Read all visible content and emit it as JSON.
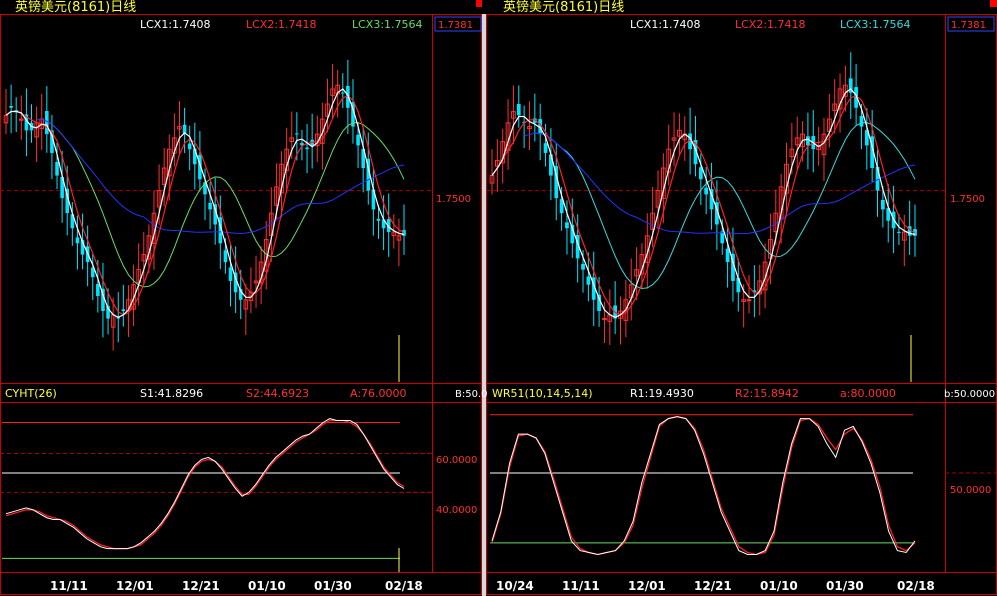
{
  "colors": {
    "bg": "#000000",
    "frame": "#cc0000",
    "up": "#ff3030",
    "down": "#00e5ff",
    "white": "#ffffff",
    "blue": "#2233ff",
    "green": "#66dd66",
    "cyan": "#33dddd",
    "yellow": "#ffff33",
    "red": "#ff2020"
  },
  "panels": [
    {
      "title": "英镑美元(8161)日线",
      "legend": [
        {
          "text": "LCX1:1.7408",
          "color": "#ffffff"
        },
        {
          "text": "LCX2:1.7418",
          "color": "#ff3030"
        },
        {
          "text": "LCX3:1.7564",
          "color": "#66dd66"
        }
      ],
      "price_badge": "1.7381",
      "price_ref_label": "1.7500",
      "ind_name": "CYHT(26)",
      "ind_legend": [
        {
          "text": "S1:41.8296",
          "color": "#ffffff"
        },
        {
          "text": "S2:44.6923",
          "color": "#ff3030"
        },
        {
          "text": "A:76.0000",
          "color": "#ff3030"
        }
      ],
      "ind_axis_top": "B:50.0",
      "ind_labels": [
        "60.0000",
        "40.0000"
      ],
      "dates": [
        "11/11",
        "12/01",
        "12/21",
        "01/10",
        "01/30",
        "02/18"
      ]
    },
    {
      "title": "英镑美元(8161)日线",
      "legend": [
        {
          "text": "LCX1:1.7408",
          "color": "#ffffff"
        },
        {
          "text": "LCX2:1.7418",
          "color": "#ff3030"
        },
        {
          "text": "LCX3:1.7564",
          "color": "#33dddd"
        }
      ],
      "price_badge": "1.7381",
      "price_ref_label": "1.7500",
      "ind_name": "WR51(10,14,5,14)",
      "ind_legend": [
        {
          "text": "R1:19.4930",
          "color": "#ffffff"
        },
        {
          "text": "R2:15.8942",
          "color": "#ff3030"
        },
        {
          "text": "a:80.0000",
          "color": "#ff3030"
        }
      ],
      "ind_axis_top": "b:50.0000",
      "ind_labels": [
        "50.0000"
      ],
      "dates": [
        "10/24",
        "11/11",
        "12/01",
        "12/21",
        "01/10",
        "01/30",
        "02/18"
      ]
    }
  ],
  "chart_data": [
    {
      "type": "candlestick",
      "title": "英镑美元(8161)日线",
      "reference_price": 1.75,
      "last_price": 1.7381,
      "ma_values": {
        "LCX1": 1.7408,
        "LCX2": 1.7418,
        "LCX3": 1.7564
      },
      "x_ticks": [
        "11/11",
        "12/01",
        "12/21",
        "01/10",
        "01/30",
        "02/18"
      ],
      "close": [
        1.77,
        1.772,
        1.771,
        1.769,
        1.766,
        1.766,
        1.768,
        1.769,
        1.765,
        1.76,
        1.754,
        1.748,
        1.744,
        1.74,
        1.736,
        1.733,
        1.731,
        1.727,
        1.722,
        1.718,
        1.716,
        1.717,
        1.716,
        1.718,
        1.721,
        1.725,
        1.729,
        1.733,
        1.738,
        1.744,
        1.75,
        1.756,
        1.761,
        1.764,
        1.767,
        1.765,
        1.761,
        1.757,
        1.753,
        1.749,
        1.745,
        1.741,
        1.736,
        1.731,
        1.726,
        1.723,
        1.721,
        1.721,
        1.723,
        1.726,
        1.731,
        1.737,
        1.744,
        1.751,
        1.757,
        1.761,
        1.764,
        1.765,
        1.762,
        1.761,
        1.762,
        1.765,
        1.769,
        1.773,
        1.777,
        1.778,
        1.776,
        1.772,
        1.767,
        1.762,
        1.756,
        1.75,
        1.745,
        1.742,
        1.74,
        1.739,
        1.739,
        1.738,
        1.738
      ],
      "indicator": {
        "name": "CYHT(26)",
        "S1": [
          29,
          30,
          31,
          32,
          31,
          29,
          27,
          26,
          26,
          24,
          22,
          19,
          16,
          14,
          12,
          11,
          11,
          11,
          11,
          12,
          14,
          17,
          20,
          24,
          29,
          35,
          42,
          49,
          54,
          57,
          58,
          56,
          52,
          47,
          42,
          38,
          40,
          44,
          49,
          54,
          58,
          61,
          64,
          67,
          69,
          70,
          73,
          76,
          78,
          77,
          77,
          77,
          75,
          70,
          64,
          58,
          52,
          48,
          44,
          42
        ],
        "S2": [
          28,
          29,
          30,
          31,
          31,
          30,
          28,
          27,
          26,
          25,
          23,
          20,
          17,
          15,
          13,
          12,
          11,
          11,
          11,
          12,
          13,
          16,
          19,
          23,
          28,
          34,
          41,
          48,
          53,
          56,
          57,
          56,
          53,
          48,
          43,
          39,
          39,
          43,
          48,
          53,
          57,
          60,
          63,
          66,
          68,
          70,
          72,
          75,
          77,
          77,
          77,
          76,
          74,
          70,
          65,
          59,
          53,
          49,
          45,
          43
        ],
        "levels": {
          "A": 76,
          "B": 50
        },
        "axis_labels": [
          60,
          40
        ]
      }
    },
    {
      "type": "candlestick",
      "title": "英镑美元(8161)日线",
      "reference_price": 1.75,
      "last_price": 1.7381,
      "ma_values": {
        "LCX1": 1.7408,
        "LCX2": 1.7418,
        "LCX3": 1.7564
      },
      "x_ticks": [
        "10/24",
        "11/11",
        "12/01",
        "12/21",
        "01/10",
        "01/30",
        "02/18"
      ],
      "close": [
        1.754,
        1.758,
        1.763,
        1.768,
        1.771,
        1.77,
        1.768,
        1.767,
        1.768,
        1.765,
        1.76,
        1.754,
        1.748,
        1.744,
        1.74,
        1.736,
        1.732,
        1.729,
        1.725,
        1.721,
        1.718,
        1.716,
        1.717,
        1.716,
        1.718,
        1.721,
        1.725,
        1.729,
        1.733,
        1.738,
        1.744,
        1.75,
        1.756,
        1.761,
        1.764,
        1.766,
        1.765,
        1.761,
        1.757,
        1.753,
        1.749,
        1.745,
        1.741,
        1.736,
        1.731,
        1.726,
        1.723,
        1.721,
        1.721,
        1.723,
        1.726,
        1.731,
        1.737,
        1.744,
        1.751,
        1.757,
        1.761,
        1.764,
        1.765,
        1.762,
        1.761,
        1.762,
        1.765,
        1.769,
        1.773,
        1.777,
        1.778,
        1.776,
        1.772,
        1.767,
        1.762,
        1.756,
        1.75,
        1.745,
        1.742,
        1.74,
        1.739,
        1.739,
        1.738,
        1.738
      ],
      "indicator": {
        "name": "WR51(10,14,5,14)",
        "R1": [
          15,
          30,
          55,
          70,
          70,
          68,
          60,
          45,
          30,
          15,
          10,
          9,
          8,
          9,
          10,
          15,
          25,
          45,
          60,
          75,
          78,
          79,
          78,
          72,
          60,
          45,
          30,
          20,
          10,
          8,
          8,
          10,
          20,
          45,
          65,
          78,
          78,
          74,
          65,
          58,
          72,
          74,
          66,
          55,
          40,
          20,
          10,
          9,
          15
        ],
        "R2": [
          14,
          29,
          53,
          69,
          70,
          68,
          61,
          47,
          32,
          17,
          11,
          9,
          8,
          9,
          10,
          14,
          23,
          42,
          58,
          74,
          78,
          79,
          78,
          73,
          62,
          47,
          32,
          22,
          12,
          9,
          8,
          9,
          18,
          42,
          63,
          77,
          78,
          75,
          68,
          62,
          70,
          73,
          67,
          57,
          43,
          23,
          12,
          10,
          14
        ],
        "levels": {
          "a": 80,
          "b": 50
        },
        "axis_labels": [
          50
        ]
      }
    }
  ]
}
